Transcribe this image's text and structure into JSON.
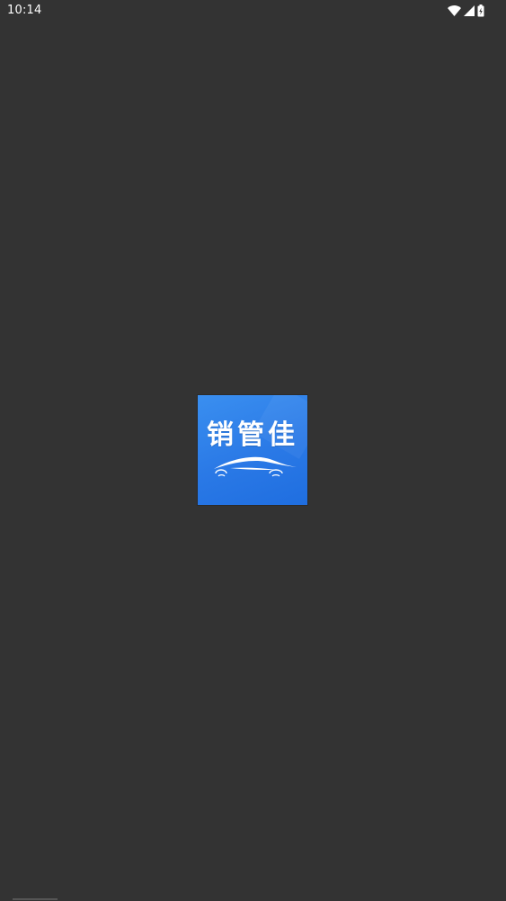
{
  "status_bar": {
    "time": "10:14",
    "icons": [
      "wifi-icon",
      "cell-signal-icon",
      "battery-charging-icon"
    ]
  },
  "splash": {
    "app_name": "销管佳",
    "logo_colors": {
      "primary": "#2a79e6",
      "light": "#3a8ff0",
      "dark": "#1f6ee0"
    },
    "logo_icon": "car-icon"
  },
  "background_color": "#333333"
}
